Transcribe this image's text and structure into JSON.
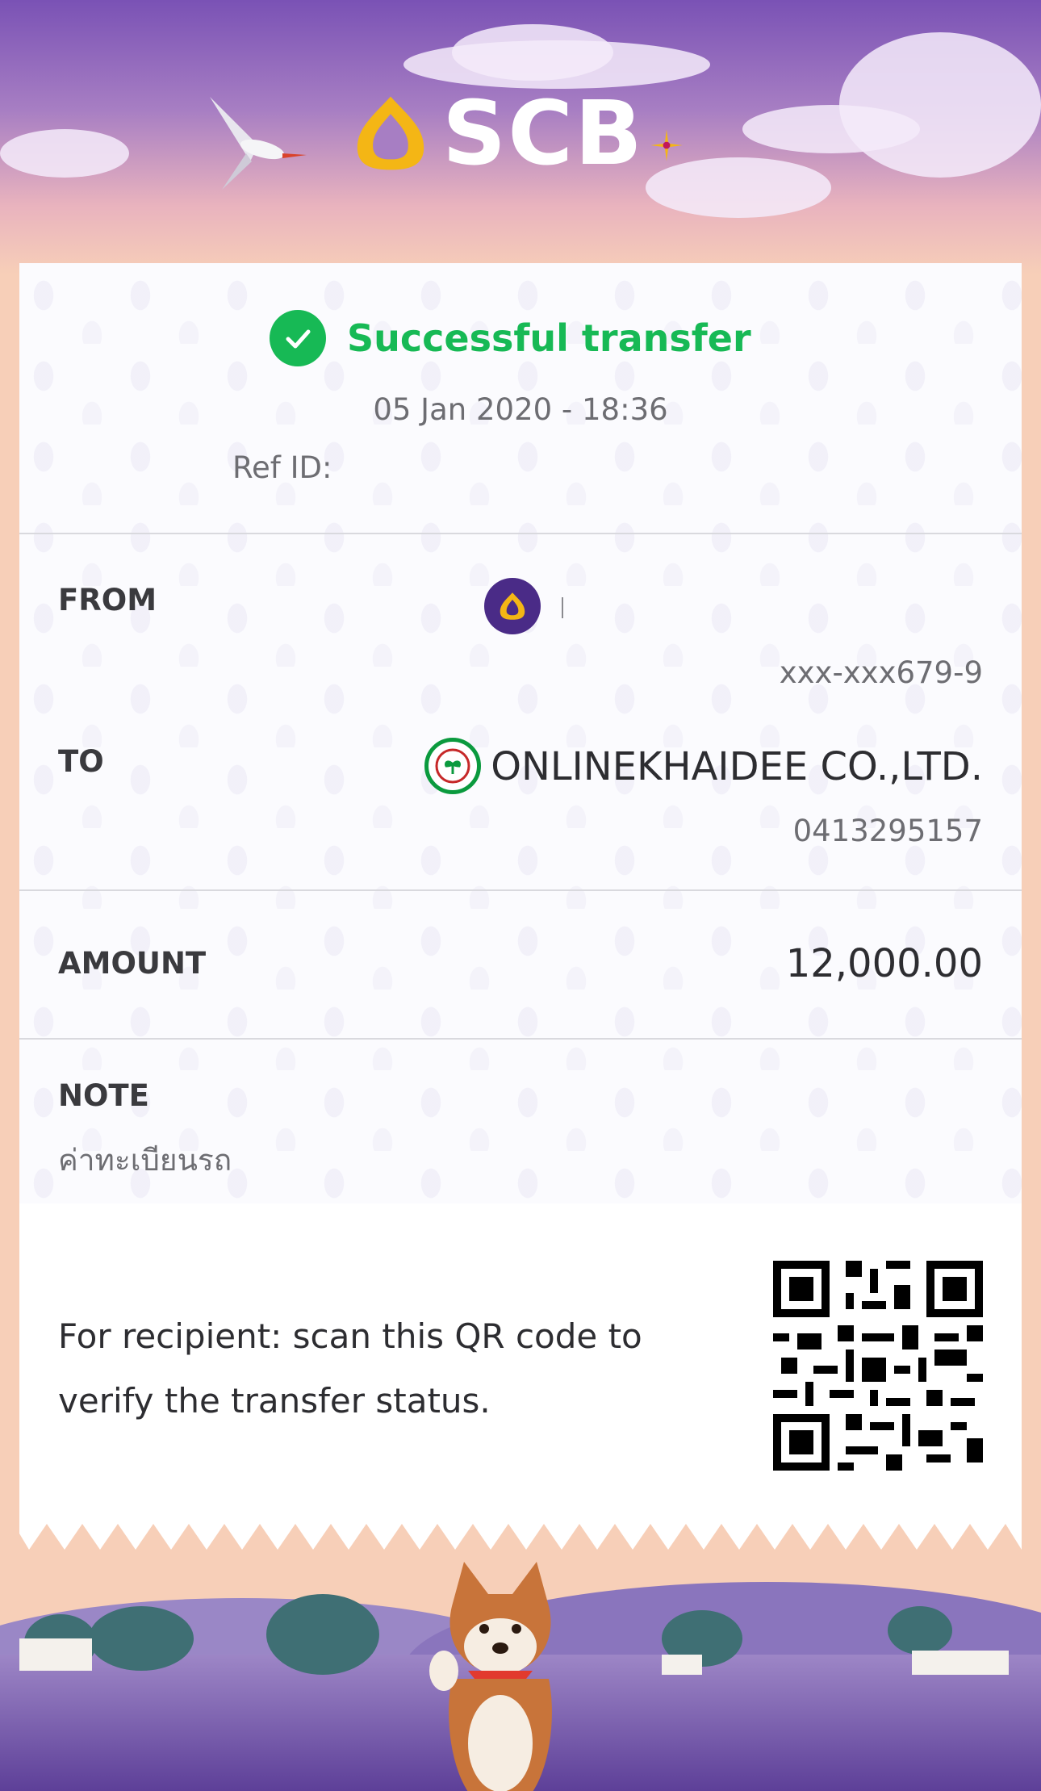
{
  "header": {
    "brand": "SCB"
  },
  "status": {
    "text": "Successful transfer",
    "datetime": "05 Jan 2020 - 18:36",
    "ref_label": "Ref ID:"
  },
  "from": {
    "label": "FROM",
    "account": "xxx-xxx679-9"
  },
  "to": {
    "label": "TO",
    "name": "ONLINEKHAIDEE CO.,LTD.",
    "account": "0413295157"
  },
  "amount": {
    "label": "AMOUNT",
    "value": "12,000.00"
  },
  "note": {
    "label": "NOTE",
    "value": "ค่าทะเบียนรถ"
  },
  "qr": {
    "text": "For recipient: scan this QR code to verify the transfer status."
  },
  "colors": {
    "success": "#17b955",
    "brand_purple": "#4a2b87",
    "brand_gold": "#f4b615"
  }
}
